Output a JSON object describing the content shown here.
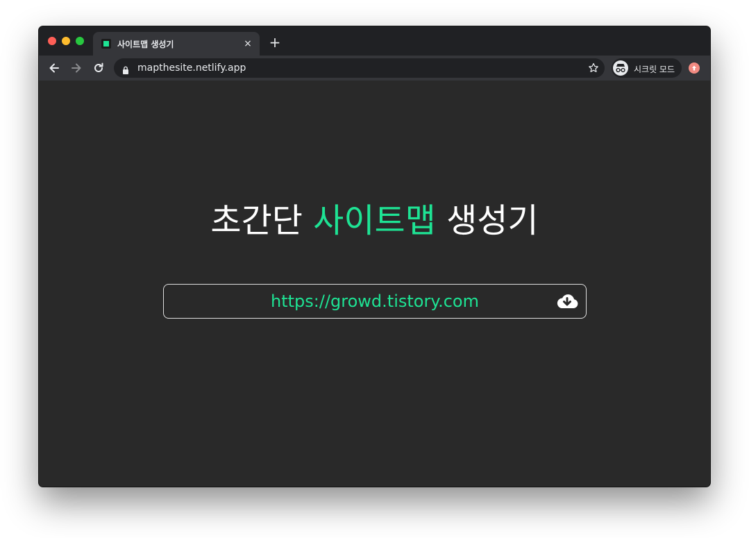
{
  "browser": {
    "tab": {
      "title": "사이트맵 생성기",
      "close": "×"
    },
    "new_tab": "+",
    "address": "mapthesite.netlify.app",
    "profile_label": "시크릿 모드"
  },
  "page": {
    "headline_pre": "초간단 ",
    "headline_accent": "사이트맵",
    "headline_post": " 생성기",
    "url_input_value": "https://growd.tistory.com"
  },
  "colors": {
    "accent": "#1ee394",
    "background": "#292929",
    "chrome_dark": "#202124",
    "chrome_toolbar": "#35363a"
  },
  "icons": [
    "favicon-icon",
    "close-icon",
    "plus-icon",
    "back-arrow-icon",
    "forward-arrow-icon",
    "reload-icon",
    "lock-icon",
    "star-icon",
    "incognito-icon",
    "extension-icon",
    "cloud-download-icon"
  ]
}
